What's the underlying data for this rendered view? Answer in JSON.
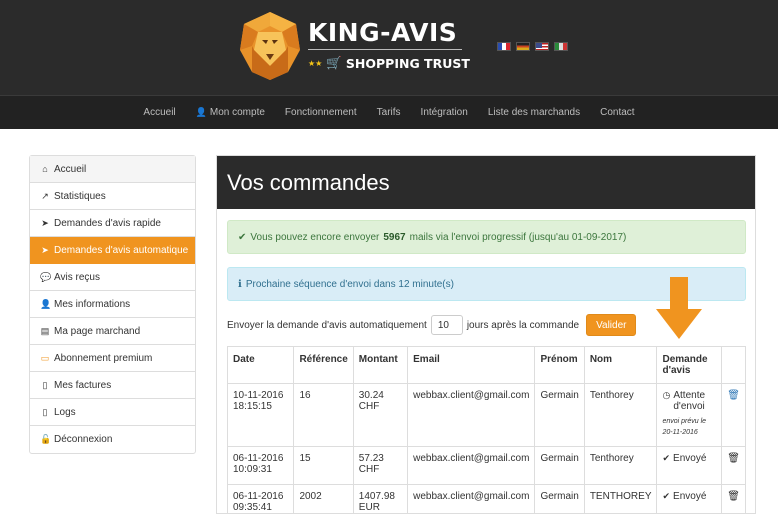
{
  "header": {
    "brand": "KING-AVIS",
    "tagline": "SHOPPING TRUST",
    "languages": [
      "fr",
      "de",
      "en",
      "it"
    ]
  },
  "nav": {
    "items": [
      {
        "label": "Accueil",
        "icon": ""
      },
      {
        "label": "Mon compte",
        "icon": "user-icon"
      },
      {
        "label": "Fonctionnement",
        "icon": ""
      },
      {
        "label": "Tarifs",
        "icon": ""
      },
      {
        "label": "Intégration",
        "icon": ""
      },
      {
        "label": "Liste des marchands",
        "icon": ""
      },
      {
        "label": "Contact",
        "icon": ""
      }
    ]
  },
  "sidebar": {
    "items": [
      {
        "label": "Accueil",
        "icon": "home-icon"
      },
      {
        "label": "Statistiques",
        "icon": "chart-icon"
      },
      {
        "label": "Demandes d'avis rapide",
        "icon": "send-icon"
      },
      {
        "label": "Demandes d'avis automatique",
        "icon": "send-icon"
      },
      {
        "label": "Avis reçus",
        "icon": "comments-icon"
      },
      {
        "label": "Mes informations",
        "icon": "user-icon"
      },
      {
        "label": "Ma page marchand",
        "icon": "file-icon"
      },
      {
        "label": "Abonnement premium",
        "icon": "credit-card-icon"
      },
      {
        "label": "Mes factures",
        "icon": "file-pdf-icon"
      },
      {
        "label": "Logs",
        "icon": "file-text-icon"
      },
      {
        "label": "Déconnexion",
        "icon": "unlock-icon"
      }
    ],
    "active_index": 3
  },
  "main": {
    "title": "Vos commandes",
    "success_alert": {
      "before": "Vous pouvez encore envoyer",
      "count": "5967",
      "after": "mails via l'envoi progressif (jusqu'au 01-09-2017)"
    },
    "info_alert": "Prochaine séquence d'envoi dans 12 minute(s)",
    "form": {
      "label_before": "Envoyer la demande d'avis automatiquement",
      "days_value": "10",
      "label_after": "jours après la commande",
      "submit_label": "Valider"
    },
    "table": {
      "headers": [
        "Date",
        "Référence",
        "Montant",
        "Email",
        "Prénom",
        "Nom",
        "Demande d'avis"
      ],
      "rows": [
        {
          "date": "10-11-2016",
          "time": "18:15:15",
          "ref": "16",
          "amount": "30.24 CHF",
          "amount2": "",
          "email": "webbax.client@gmail.com",
          "firstname": "Germain",
          "lastname": "Tenthorey",
          "status": "Attente d'envoi",
          "note": "envoi prévu le 20-11-2016",
          "status_icon": "clock-icon"
        },
        {
          "date": "06-11-2016",
          "time": "10:09:31",
          "ref": "15",
          "amount": "57.23 CHF",
          "amount2": "",
          "email": "webbax.client@gmail.com",
          "firstname": "Germain",
          "lastname": "Tenthorey",
          "status": "Envoyé",
          "note": "",
          "status_icon": "check-circle-icon"
        },
        {
          "date": "06-11-2016",
          "time": "09:35:41",
          "ref": "2002",
          "amount": "1407.98",
          "amount2": "EUR",
          "email": "webbax.client@gmail.com",
          "firstname": "Germain",
          "lastname": "TENTHOREY",
          "status": "Envoyé",
          "note": "",
          "status_icon": "check-circle-icon"
        }
      ]
    }
  },
  "colors": {
    "accent": "#f0941f",
    "header_bg": "#2b2b2b",
    "success_bg": "#dff0d8",
    "info_bg": "#d9edf7"
  }
}
